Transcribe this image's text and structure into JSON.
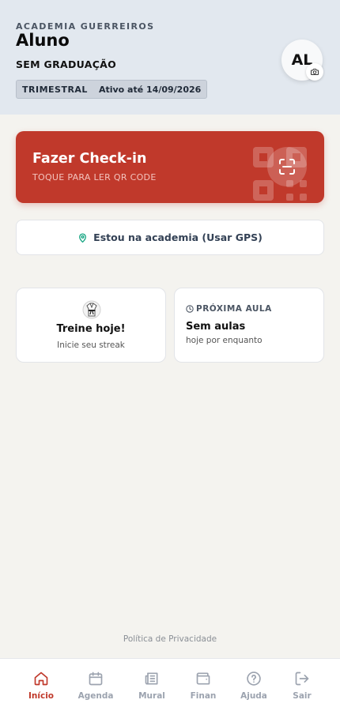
{
  "colors": {
    "accent": "#c0392b",
    "header_bg": "#e2e8ef",
    "page_bg": "#f4f3ef",
    "gps_pin": "#10a37f",
    "nav_inactive": "#9ca3af"
  },
  "header": {
    "academy": "ACADEMIA GUERREIROS",
    "student_name": "Aluno",
    "graduation": "SEM GRADUAÇÃO",
    "plan_type": "TRIMESTRAL",
    "plan_status": "Ativo até 14/09/2026",
    "avatar_initials": "AL",
    "camera_icon": "camera-icon"
  },
  "checkin": {
    "title": "Fazer Check-in",
    "subtitle": "TOQUE PARA LER QR CODE",
    "icon": "scan-icon"
  },
  "gps": {
    "label": "Estou na academia (Usar GPS)",
    "icon": "map-pin-icon"
  },
  "train_card": {
    "icon": "karate-gi-icon",
    "title": "Treine hoje!",
    "subtitle": "Inicie seu streak"
  },
  "next_class": {
    "label": "PRÓXIMA AULA",
    "icon": "clock-icon",
    "title": "Sem aulas",
    "subtitle": "hoje por enquanto"
  },
  "privacy": "Política de Privacidade",
  "nav": [
    {
      "label": "Início",
      "icon": "home-icon",
      "active": true
    },
    {
      "label": "Agenda",
      "icon": "calendar-icon",
      "active": false
    },
    {
      "label": "Mural",
      "icon": "newspaper-icon",
      "active": false
    },
    {
      "label": "Finan",
      "icon": "wallet-icon",
      "active": false
    },
    {
      "label": "Ajuda",
      "icon": "help-circle-icon",
      "active": false
    },
    {
      "label": "Sair",
      "icon": "logout-icon",
      "active": false
    }
  ]
}
